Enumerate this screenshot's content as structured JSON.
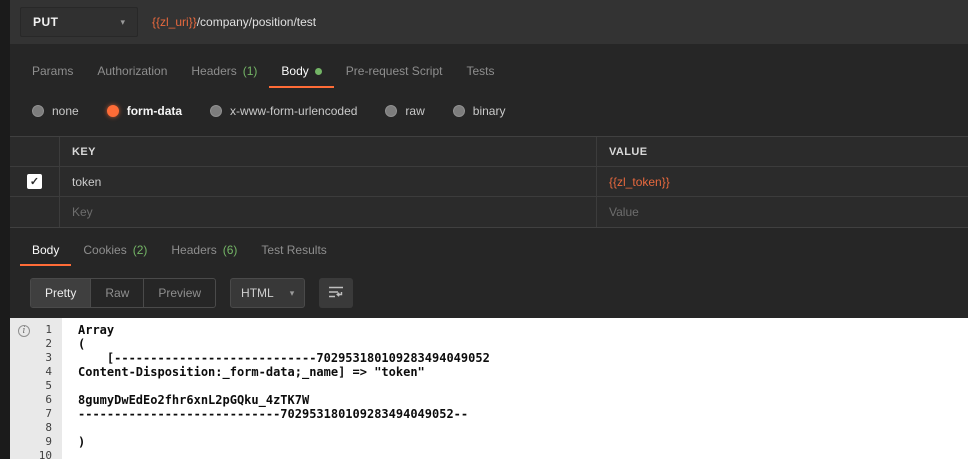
{
  "colors": {
    "accent_orange": "#ff6c37",
    "variable_orange": "#e8693e",
    "count_green": "#74b566",
    "topbar_bg": "#333333",
    "main_bg": "#262626",
    "code_bg": "#ffffff"
  },
  "icons": {
    "chevron_down": "▾",
    "check": "✓",
    "info": "i"
  },
  "request_bar": {
    "method": "PUT",
    "url_variable": "{{zl_uri}}",
    "url_path": "/company/position/test"
  },
  "request_tabs": [
    {
      "label": "Params",
      "count": ""
    },
    {
      "label": "Authorization",
      "count": ""
    },
    {
      "label": "Headers",
      "count": "(1)"
    },
    {
      "label": "Body",
      "count": ""
    },
    {
      "label": "Pre-request Script",
      "count": ""
    },
    {
      "label": "Tests",
      "count": ""
    }
  ],
  "body_types": [
    {
      "label": "none"
    },
    {
      "label": "form-data"
    },
    {
      "label": "x-www-form-urlencoded"
    },
    {
      "label": "raw"
    },
    {
      "label": "binary"
    }
  ],
  "kv_table": {
    "key_header": "KEY",
    "value_header": "VALUE",
    "rows": [
      {
        "key": "token",
        "value": "{{zl_token}}"
      }
    ],
    "placeholder": {
      "key": "Key",
      "value": "Value"
    }
  },
  "response_tabs": [
    {
      "label": "Body",
      "count": ""
    },
    {
      "label": "Cookies",
      "count": "(2)"
    },
    {
      "label": "Headers",
      "count": "(6)"
    },
    {
      "label": "Test Results",
      "count": ""
    }
  ],
  "toolbar": {
    "views": [
      "Pretty",
      "Raw",
      "Preview"
    ],
    "active_view": "Pretty",
    "format": "HTML"
  },
  "code": {
    "lines": [
      {
        "num": "1",
        "text": "Array"
      },
      {
        "num": "2",
        "text": "("
      },
      {
        "num": "3",
        "text": "    [----------------------------702953180109283494049052"
      },
      {
        "num": "4",
        "text": "Content-Disposition:_form-data;_name] => \"token\""
      },
      {
        "num": "5",
        "text": ""
      },
      {
        "num": "6",
        "text": "8gumyDwEdEo2fhr6xnL2pGQku_4zTK7W"
      },
      {
        "num": "7",
        "text": "----------------------------702953180109283494049052--"
      },
      {
        "num": "8",
        "text": ""
      },
      {
        "num": "9",
        "text": ")"
      },
      {
        "num": "10",
        "text": ""
      }
    ]
  }
}
